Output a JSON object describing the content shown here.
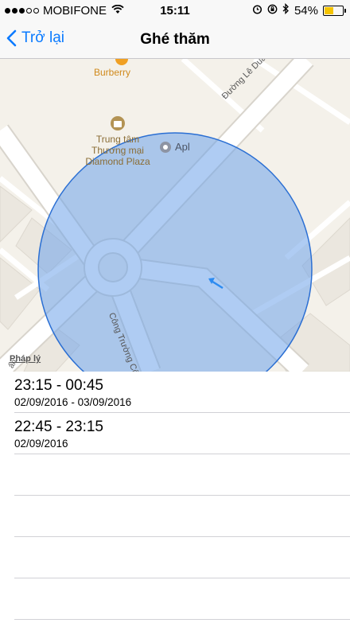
{
  "status_bar": {
    "carrier": "MOBIFONE",
    "time": "15:11",
    "battery_percent": "54%",
    "battery_level": 0.54,
    "icons": [
      "signal-dots",
      "wifi-icon",
      "alarm-icon",
      "lock-rotation-icon",
      "bluetooth-icon",
      "battery-icon"
    ]
  },
  "nav": {
    "back_label": "Trở lại",
    "title": "Ghé thăm"
  },
  "map": {
    "labels": {
      "poi_burberry": "Burberry",
      "poi_mall_line1": "Trung tâm",
      "poi_mall_line2": "Thương mại",
      "poi_mall_line3": "Diamond Plaza",
      "poi_apl": "Apl",
      "street_le_duan": "Đường Lê Duẩn",
      "street_cong_truong": "Công Trường Côn",
      "legal": "Pháp lý",
      "edge_fragment": "ẩn"
    },
    "colors": {
      "land": "#f4f1ea",
      "road": "#ffffff",
      "road_edge": "#d8d4cc",
      "circle_fill": "#6ea3ea",
      "circle_stroke": "#2b6fd3",
      "poi": "#9a7a3c",
      "poi_orange": "#f0a024",
      "arrow": "#2d8bf0"
    }
  },
  "visits": [
    {
      "time_range": "23:15 - 00:45",
      "dates": "02/09/2016 - 03/09/2016"
    },
    {
      "time_range": "22:45 - 23:15",
      "dates": "02/09/2016"
    }
  ]
}
